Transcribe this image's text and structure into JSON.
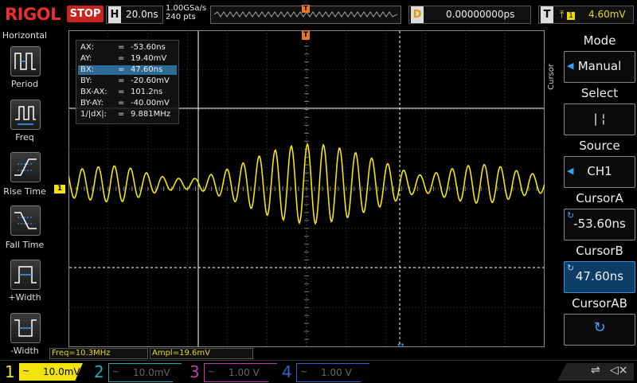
{
  "topbar": {
    "brand": "RIGOL",
    "run_state": "STOP",
    "horizontal": {
      "key": "H",
      "value": "20.0ns"
    },
    "sample_rate": "1.00GSa/s",
    "memory_depth": "240  pts",
    "trigger_marker": "T",
    "delay": {
      "key": "D",
      "value": "0.00000000ps"
    },
    "trigger": {
      "key": "T",
      "icon": "edge-trigger-icon",
      "channel": "1",
      "value": "4.60mV"
    }
  },
  "left_menu": {
    "title": "Horizontal",
    "items": [
      {
        "label": "Period",
        "icon": "period-measure-icon"
      },
      {
        "label": "Freq",
        "icon": "freq-measure-icon"
      },
      {
        "label": "Rise Time",
        "icon": "rise-time-icon"
      },
      {
        "label": "Fall Time",
        "icon": "fall-time-icon"
      },
      {
        "label": "+Width",
        "icon": "pos-width-icon"
      },
      {
        "label": "-Width",
        "icon": "neg-width-icon"
      }
    ]
  },
  "readout": {
    "rows": [
      {
        "name": "AX:",
        "eq": "=",
        "value": "-53.60ns"
      },
      {
        "name": "AY:",
        "eq": "=",
        "value": "19.40mV"
      },
      {
        "name": "BX:",
        "eq": "=",
        "value": "47.60ns"
      },
      {
        "name": "BY:",
        "eq": "=",
        "value": "-20.60mV"
      },
      {
        "name": "BX-AX:",
        "eq": "=",
        "value": "101.2ns"
      },
      {
        "name": "BY-AY:",
        "eq": "=",
        "value": "-40.00mV"
      },
      {
        "name": "1/|dX|:",
        "eq": "=",
        "value": "9.881MHz"
      }
    ],
    "selected_index": 2
  },
  "measurements": {
    "freq": "Freq=10.3MHz",
    "ampl": "Ampl=19.6mV"
  },
  "screen": {
    "trace_color": "#f2e40c",
    "channel_marker": "1",
    "trigger_level_marker": "T"
  },
  "right_menu": {
    "vertical_label": "Cursor",
    "items": [
      {
        "title": "Mode",
        "value": "Manual"
      },
      {
        "title": "Select",
        "value": "|    ¦"
      },
      {
        "title": "Source",
        "value": "CH1"
      },
      {
        "title": "CursorA",
        "value": "-53.60ns"
      },
      {
        "title": "CursorB",
        "value": "47.60ns"
      },
      {
        "title": "CursorAB",
        "value": ""
      }
    ]
  },
  "channels": [
    {
      "num": "1",
      "coupling": "~",
      "value": "10.0mV",
      "color": "#f2e40c",
      "active": true
    },
    {
      "num": "2",
      "coupling": "~",
      "value": "10.0mV",
      "color": "#28a7b8",
      "active": false
    },
    {
      "num": "3",
      "coupling": "~",
      "value": "1.00 V",
      "color": "#c23cb0",
      "active": false
    },
    {
      "num": "4",
      "coupling": "~",
      "value": "1.00 V",
      "color": "#2d62c9",
      "active": false
    }
  ],
  "status_icons": [
    "usb-icon",
    "speaker-mute-icon"
  ]
}
